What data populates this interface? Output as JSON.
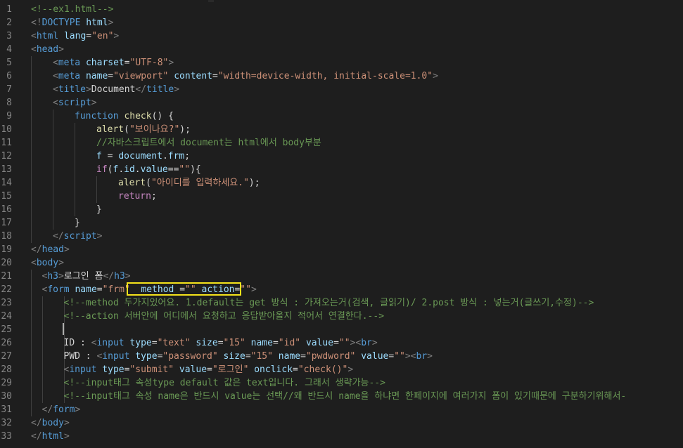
{
  "editor": {
    "theme_colors": {
      "background": "#1e1e1e",
      "tag": "#569cd6",
      "attribute": "#9cdcfe",
      "string": "#ce9178",
      "comment": "#6a9955",
      "keyword": "#c586c0",
      "function": "#dcdcaa",
      "highlight_border": "#f5e31b"
    },
    "lines": [
      {
        "n": "1",
        "indent": 0,
        "tokens": [
          [
            "t-comment",
            "<!--ex1.html-->"
          ]
        ]
      },
      {
        "n": "2",
        "indent": 0,
        "tokens": [
          [
            "t-punct",
            "<!"
          ],
          [
            "t-tag",
            "DOCTYPE"
          ],
          [
            "t-text",
            " "
          ],
          [
            "t-attr",
            "html"
          ],
          [
            "t-punct",
            ">"
          ]
        ]
      },
      {
        "n": "3",
        "indent": 0,
        "tokens": [
          [
            "t-punct",
            "<"
          ],
          [
            "t-tag",
            "html"
          ],
          [
            "t-text",
            " "
          ],
          [
            "t-attr",
            "lang"
          ],
          [
            "t-text",
            "="
          ],
          [
            "t-str",
            "\"en\""
          ],
          [
            "t-punct",
            ">"
          ]
        ]
      },
      {
        "n": "4",
        "indent": 0,
        "tokens": [
          [
            "t-punct",
            "<"
          ],
          [
            "t-tag",
            "head"
          ],
          [
            "t-punct",
            ">"
          ]
        ]
      },
      {
        "n": "5",
        "indent": 1,
        "tokens": [
          [
            "t-punct",
            "<"
          ],
          [
            "t-tag",
            "meta"
          ],
          [
            "t-text",
            " "
          ],
          [
            "t-attr",
            "charset"
          ],
          [
            "t-text",
            "="
          ],
          [
            "t-str",
            "\"UTF-8\""
          ],
          [
            "t-punct",
            ">"
          ]
        ]
      },
      {
        "n": "6",
        "indent": 1,
        "tokens": [
          [
            "t-punct",
            "<"
          ],
          [
            "t-tag",
            "meta"
          ],
          [
            "t-text",
            " "
          ],
          [
            "t-attr",
            "name"
          ],
          [
            "t-text",
            "="
          ],
          [
            "t-str",
            "\"viewport\""
          ],
          [
            "t-text",
            " "
          ],
          [
            "t-attr",
            "content"
          ],
          [
            "t-text",
            "="
          ],
          [
            "t-str",
            "\"width=device-width, initial-scale=1.0\""
          ],
          [
            "t-punct",
            ">"
          ]
        ]
      },
      {
        "n": "7",
        "indent": 1,
        "tokens": [
          [
            "t-punct",
            "<"
          ],
          [
            "t-tag",
            "title"
          ],
          [
            "t-punct",
            ">"
          ],
          [
            "t-text",
            "Document"
          ],
          [
            "t-punct",
            "</"
          ],
          [
            "t-tag",
            "title"
          ],
          [
            "t-punct",
            ">"
          ]
        ]
      },
      {
        "n": "8",
        "indent": 1,
        "tokens": [
          [
            "t-punct",
            "<"
          ],
          [
            "t-tag",
            "script"
          ],
          [
            "t-punct",
            ">"
          ]
        ]
      },
      {
        "n": "9",
        "indent": 2,
        "tokens": [
          [
            "t-decl",
            "function"
          ],
          [
            "t-text",
            " "
          ],
          [
            "t-fn",
            "check"
          ],
          [
            "t-text",
            "() {"
          ]
        ]
      },
      {
        "n": "10",
        "indent": 3,
        "tokens": [
          [
            "t-fn",
            "alert"
          ],
          [
            "t-text",
            "("
          ],
          [
            "t-str",
            "\"보이나요?\""
          ],
          [
            "t-text",
            ");"
          ]
        ]
      },
      {
        "n": "11",
        "indent": 3,
        "tokens": [
          [
            "t-comment",
            "//자바스크립트에서 document는 html에서 body부분"
          ]
        ]
      },
      {
        "n": "12",
        "indent": 3,
        "tokens": [
          [
            "t-var",
            "f"
          ],
          [
            "t-text",
            " = "
          ],
          [
            "t-var",
            "document"
          ],
          [
            "t-text",
            "."
          ],
          [
            "t-var",
            "frm"
          ],
          [
            "t-text",
            ";"
          ]
        ]
      },
      {
        "n": "13",
        "indent": 3,
        "tokens": [
          [
            "t-kw",
            "if"
          ],
          [
            "t-text",
            "("
          ],
          [
            "t-var",
            "f"
          ],
          [
            "t-text",
            "."
          ],
          [
            "t-var",
            "id"
          ],
          [
            "t-text",
            "."
          ],
          [
            "t-var",
            "value"
          ],
          [
            "t-text",
            "=="
          ],
          [
            "t-str",
            "\"\""
          ],
          [
            "t-text",
            "){"
          ]
        ]
      },
      {
        "n": "14",
        "indent": 4,
        "tokens": [
          [
            "t-fn",
            "alert"
          ],
          [
            "t-text",
            "("
          ],
          [
            "t-str",
            "\"아이디를 입력하세요.\""
          ],
          [
            "t-text",
            ");"
          ]
        ]
      },
      {
        "n": "15",
        "indent": 4,
        "tokens": [
          [
            "t-kw",
            "return"
          ],
          [
            "t-text",
            ";"
          ]
        ]
      },
      {
        "n": "16",
        "indent": 3,
        "tokens": [
          [
            "t-text",
            "}"
          ]
        ]
      },
      {
        "n": "17",
        "indent": 2,
        "tokens": [
          [
            "t-text",
            "}"
          ]
        ]
      },
      {
        "n": "18",
        "indent": 1,
        "tokens": [
          [
            "t-punct",
            "</"
          ],
          [
            "t-tag",
            "script"
          ],
          [
            "t-punct",
            ">"
          ]
        ]
      },
      {
        "n": "19",
        "indent": 0,
        "tokens": [
          [
            "t-punct",
            "</"
          ],
          [
            "t-tag",
            "head"
          ],
          [
            "t-punct",
            ">"
          ]
        ]
      },
      {
        "n": "20",
        "indent": 0,
        "tokens": [
          [
            "t-punct",
            "<"
          ],
          [
            "t-tag",
            "body"
          ],
          [
            "t-punct",
            ">"
          ]
        ]
      },
      {
        "n": "21",
        "indent": 0.5,
        "tokens": [
          [
            "t-punct",
            "<"
          ],
          [
            "t-tag",
            "h3"
          ],
          [
            "t-punct",
            ">"
          ],
          [
            "t-text",
            "로그인 폼"
          ],
          [
            "t-punct",
            "</"
          ],
          [
            "t-tag",
            "h3"
          ],
          [
            "t-punct",
            ">"
          ]
        ]
      },
      {
        "n": "22",
        "indent": 0.5,
        "tokens": [
          [
            "t-punct",
            "<"
          ],
          [
            "t-tag",
            "form"
          ],
          [
            "t-text",
            " "
          ],
          [
            "t-attr",
            "name"
          ],
          [
            "t-text",
            "="
          ],
          [
            "t-str",
            "\"frm\""
          ],
          [
            "t-text",
            "  "
          ],
          [
            "t-attr",
            "method"
          ],
          [
            "t-text",
            " ="
          ],
          [
            "t-str",
            "\"\""
          ],
          [
            "t-text",
            " "
          ],
          [
            "t-attr",
            "action"
          ],
          [
            "t-text",
            "="
          ],
          [
            "t-str",
            "\"\""
          ],
          [
            "t-punct",
            ">"
          ]
        ]
      },
      {
        "n": "23",
        "indent": 1.5,
        "tokens": [
          [
            "t-comment",
            "<!--method 두가지있어요. 1.default는 get 방식 : 가져오는거(검색, 글읽기)/ 2.post 방식 : 넣는거(글쓰기,수정)-->"
          ]
        ]
      },
      {
        "n": "24",
        "indent": 1.5,
        "tokens": [
          [
            "t-comment",
            "<!--action 서버안에 어디에서 요청하고 응답받아올지 적어서 연결한다.-->"
          ]
        ]
      },
      {
        "n": "25",
        "indent": 1.5,
        "tokens": []
      },
      {
        "n": "26",
        "indent": 1.5,
        "tokens": [
          [
            "t-text",
            "ID : "
          ],
          [
            "t-punct",
            "<"
          ],
          [
            "t-tag",
            "input"
          ],
          [
            "t-text",
            " "
          ],
          [
            "t-attr",
            "type"
          ],
          [
            "t-text",
            "="
          ],
          [
            "t-str",
            "\"text\""
          ],
          [
            "t-text",
            " "
          ],
          [
            "t-attr",
            "size"
          ],
          [
            "t-text",
            "="
          ],
          [
            "t-str",
            "\"15\""
          ],
          [
            "t-text",
            " "
          ],
          [
            "t-attr",
            "name"
          ],
          [
            "t-text",
            "="
          ],
          [
            "t-str",
            "\"id\""
          ],
          [
            "t-text",
            " "
          ],
          [
            "t-attr",
            "value"
          ],
          [
            "t-text",
            "="
          ],
          [
            "t-str",
            "\"\""
          ],
          [
            "t-punct",
            "><"
          ],
          [
            "t-tag",
            "br"
          ],
          [
            "t-punct",
            ">"
          ]
        ]
      },
      {
        "n": "27",
        "indent": 1.5,
        "tokens": [
          [
            "t-text",
            "PWD : "
          ],
          [
            "t-punct",
            "<"
          ],
          [
            "t-tag",
            "input"
          ],
          [
            "t-text",
            " "
          ],
          [
            "t-attr",
            "type"
          ],
          [
            "t-text",
            "="
          ],
          [
            "t-str",
            "\"password\""
          ],
          [
            "t-text",
            " "
          ],
          [
            "t-attr",
            "size"
          ],
          [
            "t-text",
            "="
          ],
          [
            "t-str",
            "\"15\""
          ],
          [
            "t-text",
            " "
          ],
          [
            "t-attr",
            "name"
          ],
          [
            "t-text",
            "="
          ],
          [
            "t-str",
            "\"pwdword\""
          ],
          [
            "t-text",
            " "
          ],
          [
            "t-attr",
            "value"
          ],
          [
            "t-text",
            "="
          ],
          [
            "t-str",
            "\"\""
          ],
          [
            "t-punct",
            "><"
          ],
          [
            "t-tag",
            "br"
          ],
          [
            "t-punct",
            ">"
          ]
        ]
      },
      {
        "n": "28",
        "indent": 1.5,
        "tokens": [
          [
            "t-punct",
            "<"
          ],
          [
            "t-tag",
            "input"
          ],
          [
            "t-text",
            " "
          ],
          [
            "t-attr",
            "type"
          ],
          [
            "t-text",
            "="
          ],
          [
            "t-str",
            "\"submit\""
          ],
          [
            "t-text",
            " "
          ],
          [
            "t-attr",
            "value"
          ],
          [
            "t-text",
            "="
          ],
          [
            "t-str",
            "\"로그인\""
          ],
          [
            "t-text",
            " "
          ],
          [
            "t-attr",
            "onclick"
          ],
          [
            "t-text",
            "="
          ],
          [
            "t-str",
            "\"check()\""
          ],
          [
            "t-punct",
            ">"
          ]
        ]
      },
      {
        "n": "29",
        "indent": 1.5,
        "tokens": [
          [
            "t-comment",
            "<!--input태그 속성type default 값은 text입니다. 그래서 생략가능-->"
          ]
        ]
      },
      {
        "n": "30",
        "indent": 1.5,
        "tokens": [
          [
            "t-comment",
            "<!--input태그 속성 name은 반드시 value는 선택//왜 반드시 name을 하냐면 한페이지에 여러가지 폼이 있기때문에 구분하기위해서-"
          ]
        ]
      },
      {
        "n": "31",
        "indent": 0.5,
        "tokens": [
          [
            "t-punct",
            "</"
          ],
          [
            "t-tag",
            "form"
          ],
          [
            "t-punct",
            ">"
          ]
        ]
      },
      {
        "n": "32",
        "indent": 0,
        "tokens": [
          [
            "t-punct",
            "</"
          ],
          [
            "t-tag",
            "body"
          ],
          [
            "t-punct",
            ">"
          ]
        ]
      },
      {
        "n": "33",
        "indent": 0,
        "tokens": [
          [
            "t-punct",
            "</"
          ],
          [
            "t-tag",
            "html"
          ],
          [
            "t-punct",
            ">"
          ]
        ]
      }
    ]
  }
}
